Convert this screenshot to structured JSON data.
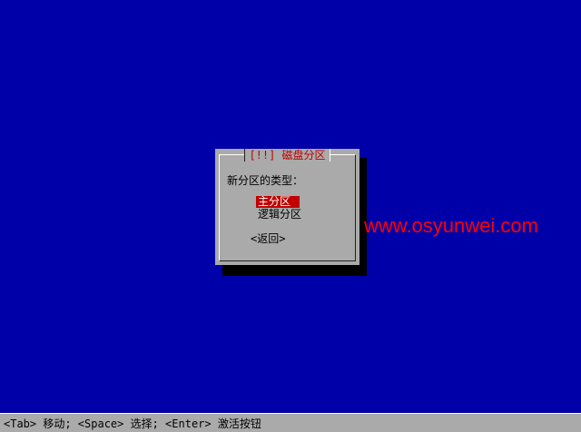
{
  "dialog": {
    "title": "[!!] 磁盘分区",
    "prompt": "新分区的类型：",
    "options": [
      "主分区",
      "逻辑分区"
    ],
    "selected_index": 0,
    "back_label": "<返回>"
  },
  "watermark": "www.osyunwei.com",
  "status_bar": {
    "text": "<Tab> 移动; <Space> 选择; <Enter> 激活按钮"
  },
  "colors": {
    "background": "#0000a8",
    "dialog": "#aaaaaa",
    "accent": "#c00000",
    "watermark": "#ff0000"
  }
}
